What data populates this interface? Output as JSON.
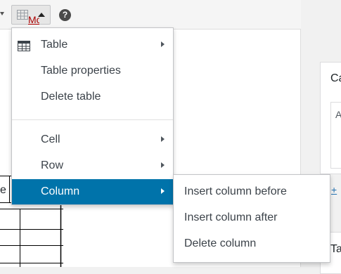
{
  "toolbar": {
    "table_button": "table-icon",
    "help_button": "?"
  },
  "editor": {
    "partial_text": "e"
  },
  "sidebar": {
    "link_partial": "Mo",
    "heading_partial": "Ca",
    "inner_text_partial": "A",
    "add_partial": "+",
    "heading2_partial": "Ta"
  },
  "menu": {
    "items": [
      {
        "label": "Table",
        "icon": "table-icon",
        "has_submenu": true
      },
      {
        "label": "Table properties",
        "has_submenu": false
      },
      {
        "label": "Delete table",
        "has_submenu": false
      },
      {
        "label": "Cell",
        "has_submenu": true
      },
      {
        "label": "Row",
        "has_submenu": true
      },
      {
        "label": "Column",
        "has_submenu": true,
        "active": true
      }
    ]
  },
  "submenu": {
    "items": [
      {
        "label": "Insert column before"
      },
      {
        "label": "Insert column after"
      },
      {
        "label": "Delete column"
      }
    ]
  },
  "colors": {
    "active_bg": "#0073aa",
    "link_red": "#aa0000",
    "link_blue": "#2271b1"
  }
}
